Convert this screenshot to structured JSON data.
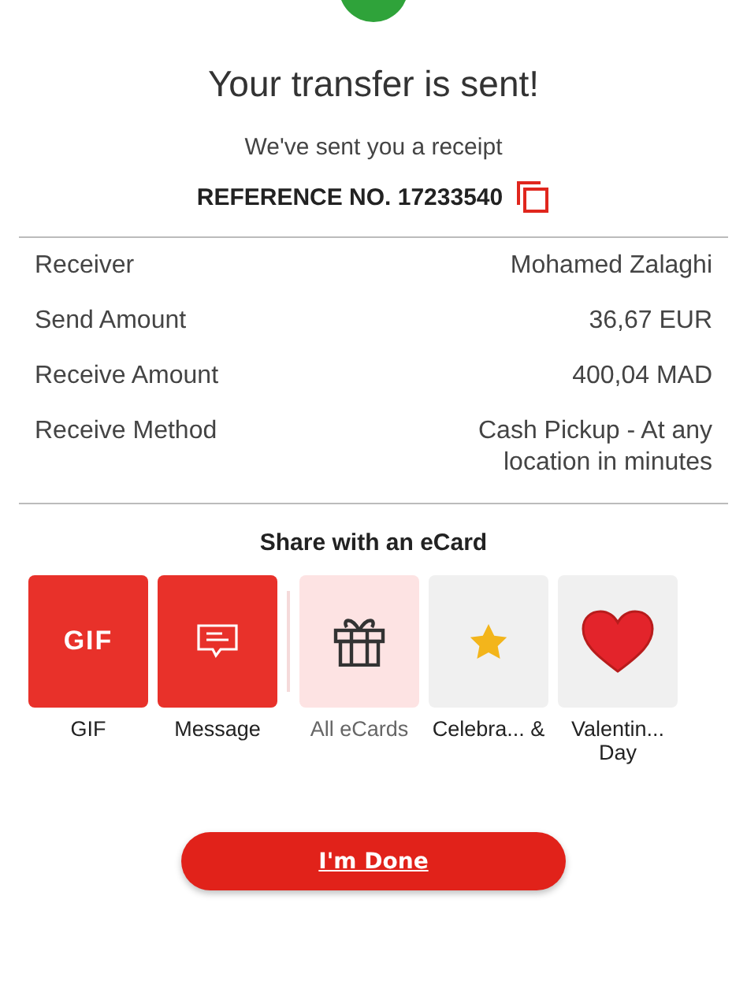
{
  "title": "Your transfer is sent!",
  "subtitle": "We've sent you a receipt",
  "reference": "REFERENCE NO. 17233540",
  "details": [
    {
      "label": "Receiver",
      "value": "Mohamed Zalaghi"
    },
    {
      "label": "Send Amount",
      "value": "36,67 EUR"
    },
    {
      "label": "Receive Amount",
      "value": "400,04 MAD"
    },
    {
      "label": "Receive Method",
      "value": "Cash Pickup - At any location in minutes"
    }
  ],
  "share": {
    "heading": "Share with an eCard",
    "cards": [
      {
        "kind": "gif",
        "icon_text": "GIF",
        "label": "GIF"
      },
      {
        "kind": "message",
        "label": "Message"
      },
      {
        "kind": "all",
        "label": "All eCards"
      },
      {
        "kind": "star",
        "label": "Celebra... &"
      },
      {
        "kind": "heart",
        "label": "Valentin... Day"
      }
    ]
  },
  "done_button": "I'm Done"
}
